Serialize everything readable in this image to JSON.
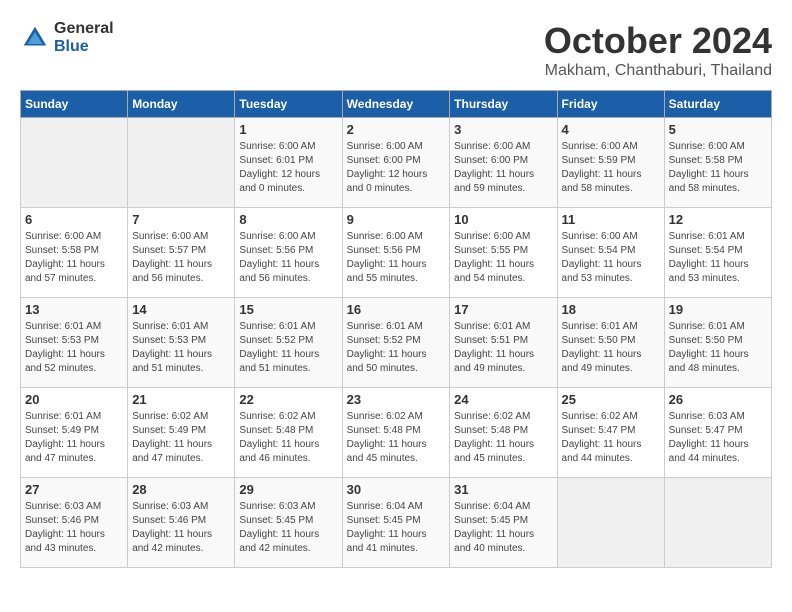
{
  "logo": {
    "line1": "General",
    "line2": "Blue"
  },
  "title": "October 2024",
  "location": "Makham, Chanthaburi, Thailand",
  "days_of_week": [
    "Sunday",
    "Monday",
    "Tuesday",
    "Wednesday",
    "Thursday",
    "Friday",
    "Saturday"
  ],
  "weeks": [
    [
      {
        "day": "",
        "empty": true
      },
      {
        "day": "",
        "empty": true
      },
      {
        "day": "1",
        "sunrise": "6:00 AM",
        "sunset": "6:01 PM",
        "daylight": "12 hours and 0 minutes."
      },
      {
        "day": "2",
        "sunrise": "6:00 AM",
        "sunset": "6:00 PM",
        "daylight": "12 hours and 0 minutes."
      },
      {
        "day": "3",
        "sunrise": "6:00 AM",
        "sunset": "6:00 PM",
        "daylight": "11 hours and 59 minutes."
      },
      {
        "day": "4",
        "sunrise": "6:00 AM",
        "sunset": "5:59 PM",
        "daylight": "11 hours and 58 minutes."
      },
      {
        "day": "5",
        "sunrise": "6:00 AM",
        "sunset": "5:58 PM",
        "daylight": "11 hours and 58 minutes."
      }
    ],
    [
      {
        "day": "6",
        "sunrise": "6:00 AM",
        "sunset": "5:58 PM",
        "daylight": "11 hours and 57 minutes."
      },
      {
        "day": "7",
        "sunrise": "6:00 AM",
        "sunset": "5:57 PM",
        "daylight": "11 hours and 56 minutes."
      },
      {
        "day": "8",
        "sunrise": "6:00 AM",
        "sunset": "5:56 PM",
        "daylight": "11 hours and 56 minutes."
      },
      {
        "day": "9",
        "sunrise": "6:00 AM",
        "sunset": "5:56 PM",
        "daylight": "11 hours and 55 minutes."
      },
      {
        "day": "10",
        "sunrise": "6:00 AM",
        "sunset": "5:55 PM",
        "daylight": "11 hours and 54 minutes."
      },
      {
        "day": "11",
        "sunrise": "6:00 AM",
        "sunset": "5:54 PM",
        "daylight": "11 hours and 53 minutes."
      },
      {
        "day": "12",
        "sunrise": "6:01 AM",
        "sunset": "5:54 PM",
        "daylight": "11 hours and 53 minutes."
      }
    ],
    [
      {
        "day": "13",
        "sunrise": "6:01 AM",
        "sunset": "5:53 PM",
        "daylight": "11 hours and 52 minutes."
      },
      {
        "day": "14",
        "sunrise": "6:01 AM",
        "sunset": "5:53 PM",
        "daylight": "11 hours and 51 minutes."
      },
      {
        "day": "15",
        "sunrise": "6:01 AM",
        "sunset": "5:52 PM",
        "daylight": "11 hours and 51 minutes."
      },
      {
        "day": "16",
        "sunrise": "6:01 AM",
        "sunset": "5:52 PM",
        "daylight": "11 hours and 50 minutes."
      },
      {
        "day": "17",
        "sunrise": "6:01 AM",
        "sunset": "5:51 PM",
        "daylight": "11 hours and 49 minutes."
      },
      {
        "day": "18",
        "sunrise": "6:01 AM",
        "sunset": "5:50 PM",
        "daylight": "11 hours and 49 minutes."
      },
      {
        "day": "19",
        "sunrise": "6:01 AM",
        "sunset": "5:50 PM",
        "daylight": "11 hours and 48 minutes."
      }
    ],
    [
      {
        "day": "20",
        "sunrise": "6:01 AM",
        "sunset": "5:49 PM",
        "daylight": "11 hours and 47 minutes."
      },
      {
        "day": "21",
        "sunrise": "6:02 AM",
        "sunset": "5:49 PM",
        "daylight": "11 hours and 47 minutes."
      },
      {
        "day": "22",
        "sunrise": "6:02 AM",
        "sunset": "5:48 PM",
        "daylight": "11 hours and 46 minutes."
      },
      {
        "day": "23",
        "sunrise": "6:02 AM",
        "sunset": "5:48 PM",
        "daylight": "11 hours and 45 minutes."
      },
      {
        "day": "24",
        "sunrise": "6:02 AM",
        "sunset": "5:48 PM",
        "daylight": "11 hours and 45 minutes."
      },
      {
        "day": "25",
        "sunrise": "6:02 AM",
        "sunset": "5:47 PM",
        "daylight": "11 hours and 44 minutes."
      },
      {
        "day": "26",
        "sunrise": "6:03 AM",
        "sunset": "5:47 PM",
        "daylight": "11 hours and 44 minutes."
      }
    ],
    [
      {
        "day": "27",
        "sunrise": "6:03 AM",
        "sunset": "5:46 PM",
        "daylight": "11 hours and 43 minutes."
      },
      {
        "day": "28",
        "sunrise": "6:03 AM",
        "sunset": "5:46 PM",
        "daylight": "11 hours and 42 minutes."
      },
      {
        "day": "29",
        "sunrise": "6:03 AM",
        "sunset": "5:45 PM",
        "daylight": "11 hours and 42 minutes."
      },
      {
        "day": "30",
        "sunrise": "6:04 AM",
        "sunset": "5:45 PM",
        "daylight": "11 hours and 41 minutes."
      },
      {
        "day": "31",
        "sunrise": "6:04 AM",
        "sunset": "5:45 PM",
        "daylight": "11 hours and 40 minutes."
      },
      {
        "day": "",
        "empty": true
      },
      {
        "day": "",
        "empty": true
      }
    ]
  ]
}
